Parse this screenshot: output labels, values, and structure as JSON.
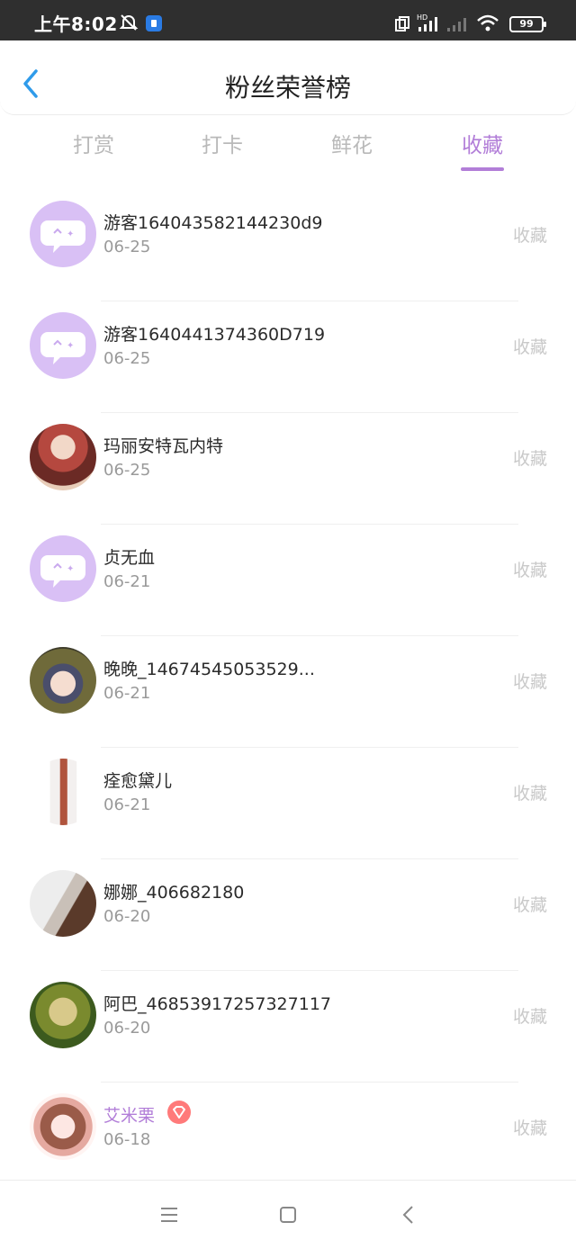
{
  "status_bar": {
    "time": "上午8:02",
    "battery": "99",
    "icons": [
      "bell-off-icon",
      "app-notification-icon",
      "dual-sim-icon",
      "hd-signal-icon",
      "signal-icon",
      "wifi-icon",
      "battery-icon"
    ]
  },
  "header": {
    "title": "粉丝荣誉榜",
    "back_icon": "chevron-left-icon"
  },
  "tabs": [
    {
      "label": "打赏",
      "active": false
    },
    {
      "label": "打卡",
      "active": false
    },
    {
      "label": "鲜花",
      "active": false
    },
    {
      "label": "收藏",
      "active": true
    }
  ],
  "accent_color": "#b27ed8",
  "list": {
    "items": [
      {
        "name": "游客164043582144230d9",
        "date": "06-25",
        "action": "收藏",
        "avatar": "default-chat-avatar"
      },
      {
        "name": "游客1640441374360D719",
        "date": "06-25",
        "action": "收藏",
        "avatar": "default-chat-avatar"
      },
      {
        "name": "玛丽安特瓦内特",
        "date": "06-25",
        "action": "收藏",
        "avatar": "user-photo-avatar"
      },
      {
        "name": "贞无血",
        "date": "06-21",
        "action": "收藏",
        "avatar": "default-chat-avatar"
      },
      {
        "name": "晚晚_14674545053529...",
        "date": "06-21",
        "action": "收藏",
        "avatar": "user-photo-avatar"
      },
      {
        "name": "痊愈黛儿",
        "date": "06-21",
        "action": "收藏",
        "avatar": "user-photo-avatar"
      },
      {
        "name": "娜娜_406682180",
        "date": "06-20",
        "action": "收藏",
        "avatar": "user-photo-avatar"
      },
      {
        "name": "阿巴_46853917257327117",
        "date": "06-20",
        "action": "收藏",
        "avatar": "user-photo-avatar"
      },
      {
        "name": "艾米栗",
        "date": "06-18",
        "action": "收藏",
        "avatar": "user-photo-avatar",
        "vip": true
      }
    ]
  },
  "navbar": {
    "icons": [
      "menu-icon",
      "home-square-icon",
      "back-triangle-icon"
    ]
  }
}
